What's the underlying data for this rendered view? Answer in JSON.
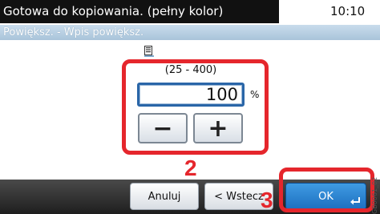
{
  "header": {
    "title": "Gotowa do kopiowania. (pełny kolor)",
    "time": "10:10"
  },
  "subtitle": "Powiększ. - Wpis powiększ.",
  "zoom": {
    "range": "(25 - 400)",
    "value": "100",
    "unit": "%",
    "minus_symbol": "−",
    "plus_symbol": "+"
  },
  "steps": {
    "step2": "2",
    "step3": "3"
  },
  "footer": {
    "cancel_label": "Anuluj",
    "back_label": "< Wstecz",
    "ok_label": "OK"
  },
  "side_code": "GB0061_02",
  "colors": {
    "highlight": "#e5262c",
    "ok_button": "#1d6fbf",
    "title_bar": "#111111"
  }
}
